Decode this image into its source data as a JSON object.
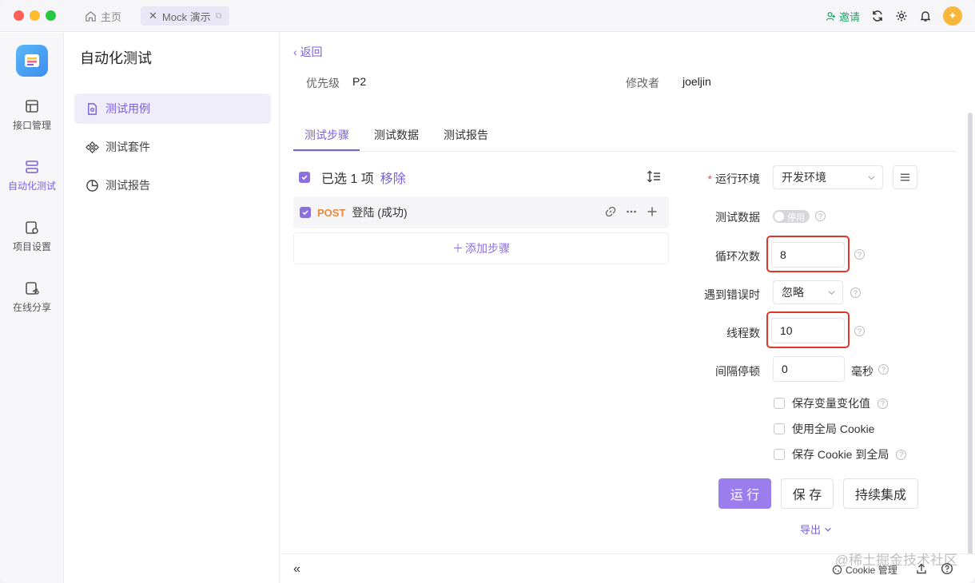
{
  "titlebar": {
    "home_tab": "主页",
    "active_tab": "Mock 演示",
    "invite": "邀请"
  },
  "rail": {
    "items": [
      {
        "label": "接口管理"
      },
      {
        "label": "自动化测试"
      },
      {
        "label": "项目设置"
      },
      {
        "label": "在线分享"
      }
    ]
  },
  "subnav": {
    "title": "自动化测试",
    "items": [
      {
        "label": "测试用例"
      },
      {
        "label": "测试套件"
      },
      {
        "label": "测试报告"
      }
    ]
  },
  "main": {
    "back": "返回",
    "priority_label": "优先级",
    "priority_value": "P2",
    "modifier_label": "修改者",
    "modifier_value": "joeljin",
    "tabs": [
      {
        "label": "测试步骤"
      },
      {
        "label": "测试数据"
      },
      {
        "label": "测试报告"
      }
    ],
    "selection_text": "已选 1 项",
    "remove": "移除",
    "step": {
      "method": "POST",
      "name": "登陆 (成功)"
    },
    "add_step": "添加步骤"
  },
  "config": {
    "env_label": "运行环境",
    "env_value": "开发环境",
    "test_data_label": "测试数据",
    "test_data_toggle": "停用",
    "loop_label": "循环次数",
    "loop_value": "8",
    "on_error_label": "遇到错误时",
    "on_error_value": "忽略",
    "threads_label": "线程数",
    "threads_value": "10",
    "interval_label": "间隔停顿",
    "interval_value": "0",
    "interval_unit": "毫秒",
    "checkboxes": [
      {
        "label": "保存变量变化值"
      },
      {
        "label": "使用全局 Cookie"
      },
      {
        "label": "保存 Cookie 到全局"
      }
    ],
    "run": "运 行",
    "save": "保 存",
    "ci": "持续集成",
    "export": "导出"
  },
  "footer": {
    "cookie": "Cookie 管理"
  },
  "watermark": "@稀土掘金技术社区",
  "colors": {
    "accent": "#7b61d9",
    "highlight": "#e2362b",
    "method_post": "#e8883b"
  }
}
